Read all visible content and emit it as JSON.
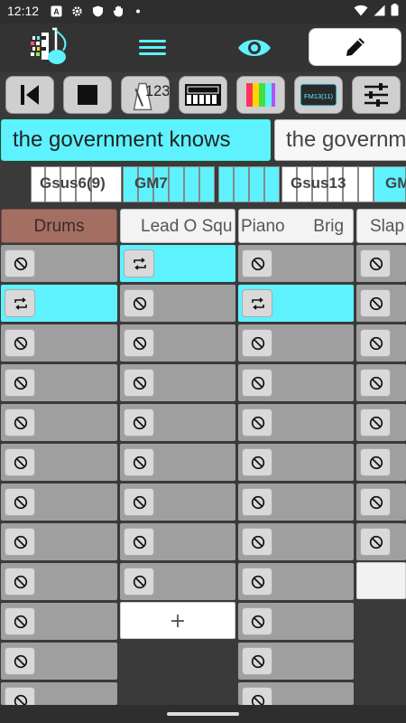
{
  "status_bar": {
    "time": "12:12"
  },
  "toolbar": {
    "icons": [
      "app-logo",
      "hamburger-menu",
      "eye",
      "pencil"
    ]
  },
  "controls": [
    {
      "name": "back-to-start-icon"
    },
    {
      "name": "stop-icon"
    },
    {
      "name": "metronome-icon",
      "label": "123"
    },
    {
      "name": "piano-keyboard-icon"
    },
    {
      "name": "color-palette-icon"
    },
    {
      "name": "synth-device-icon",
      "label": "FM13(11)"
    },
    {
      "name": "mixer-sliders-icon"
    }
  ],
  "lyrics": {
    "current": "the government knows",
    "next": "the governm"
  },
  "chords": [
    "Gsus6(9)",
    "GM7",
    "Gsus13",
    "GM"
  ],
  "tracks": [
    {
      "name": "Drums"
    },
    {
      "name": "Lead O Squ"
    },
    {
      "name": "Piano      Brig"
    },
    {
      "name": "Slap"
    }
  ],
  "add_label": "+",
  "colors": {
    "accent": "#5ef2ff",
    "drums_header": "#a46f62",
    "cell_gray": "#9f9f9f"
  }
}
